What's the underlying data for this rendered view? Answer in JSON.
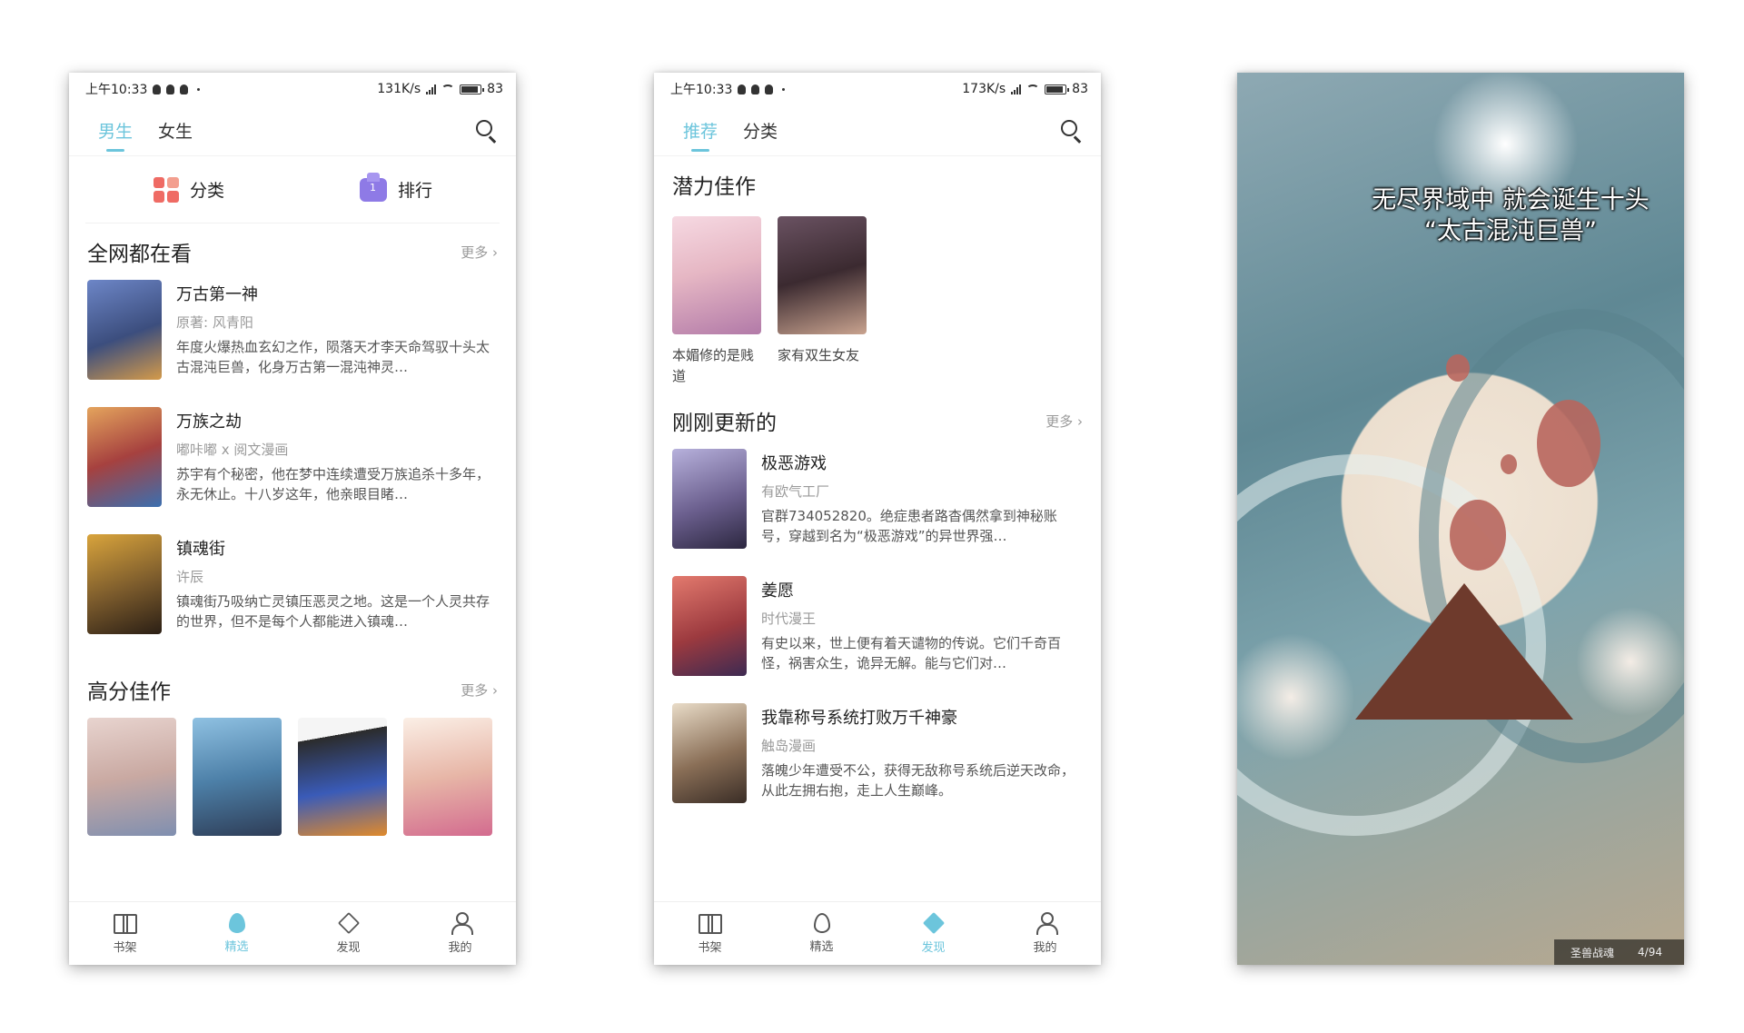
{
  "phone1": {
    "status": {
      "time": "上午10:33",
      "speed": "131K/s",
      "battery": "83"
    },
    "tabs": [
      {
        "label": "男生",
        "active": true
      },
      {
        "label": "女生",
        "active": false
      }
    ],
    "quick_entries": {
      "category": "分类",
      "ranking": "排行"
    },
    "section1": {
      "title": "全网都在看",
      "more": "更多 ›",
      "books": [
        {
          "title": "万古第一神",
          "author": "原著: 风青阳",
          "desc": "年度火爆热血玄幻之作，陨落天才李天命驾驭十头太古混沌巨兽，化身万古第一混沌神灵…",
          "cover_color": "#3c4e7e"
        },
        {
          "title": "万族之劫",
          "author": "嘟咔嘟 x 阅文漫画",
          "desc": "苏宇有个秘密，他在梦中连续遭受万族追杀十多年，永无休止。十八岁这年，他亲眼目睹…",
          "cover_color": "#a6413f"
        },
        {
          "title": "镇魂街",
          "author": "许辰",
          "desc": "镇魂街乃吸纳亡灵镇压恶灵之地。这是一个人灵共存的世界，但不是每个人都能进入镇魂…",
          "cover_color": "#7a5a2c"
        }
      ]
    },
    "section2": {
      "title": "高分佳作",
      "more": "更多 ›",
      "cover_colors": [
        "#c9a9a2",
        "#4d80a8",
        "#2b2b2b",
        "#e7b6a7"
      ]
    },
    "nav": [
      {
        "label": "书架",
        "icon": "book-icon",
        "active": false
      },
      {
        "label": "精选",
        "icon": "flame-icon",
        "active": true
      },
      {
        "label": "发现",
        "icon": "cube-icon",
        "active": false
      },
      {
        "label": "我的",
        "icon": "user-icon",
        "active": false
      }
    ]
  },
  "phone2": {
    "status": {
      "time": "上午10:33",
      "speed": "173K/s",
      "battery": "83"
    },
    "tabs": [
      {
        "label": "推荐",
        "active": true
      },
      {
        "label": "分类",
        "active": false
      }
    ],
    "potential": {
      "title": "潜力佳作",
      "items": [
        {
          "title": "本媚修的是贱道",
          "cover_color": "#e6b7c4"
        },
        {
          "title": "家有双生女友",
          "cover_color": "#3b2a30"
        }
      ]
    },
    "recent": {
      "title": "刚刚更新的",
      "more": "更多 ›",
      "books": [
        {
          "title": "极恶游戏",
          "author": "有欧气工厂",
          "desc": "官群734052820。绝症患者路杳偶然拿到神秘账号，穿越到名为“极恶游戏”的异世界强…",
          "cover_color": "#6b5f8e"
        },
        {
          "title": "姜愿",
          "author": "时代漫王",
          "desc": "有史以来，世上便有着天谴物的传说。它们千奇百怪，祸害众生，诡异无解。能与它们对…",
          "cover_color": "#9c3a3f"
        },
        {
          "title": "我靠称号系统打败万千神豪",
          "author": "触岛漫画",
          "desc": "落魄少年遭受不公，获得无敌称号系统后逆天改命，从此左拥右抱，走上人生巅峰。",
          "cover_color": "#8a6f57"
        }
      ]
    },
    "nav": [
      {
        "label": "书架",
        "icon": "book-icon",
        "active": false
      },
      {
        "label": "精选",
        "icon": "flame-icon",
        "active": false
      },
      {
        "label": "发现",
        "icon": "cube-icon",
        "active": true
      },
      {
        "label": "我的",
        "icon": "user-icon",
        "active": false
      }
    ]
  },
  "phone3": {
    "caption_line1": "无尽界域中 就会诞生十头",
    "caption_line2": "“太古混沌巨兽”",
    "footer_title": "圣兽战魂",
    "footer_page": "4/94"
  },
  "colors": {
    "accent": "#6cc5dc",
    "text": "#222222",
    "muted": "#9a9a9a"
  }
}
